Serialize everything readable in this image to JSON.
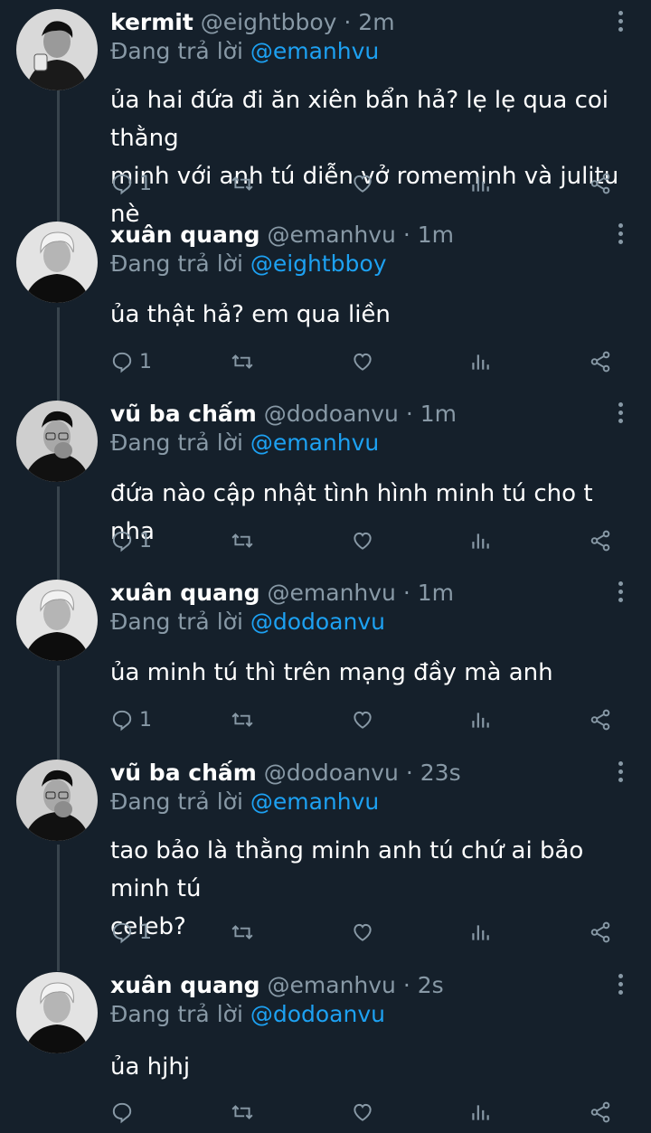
{
  "reply_prefix": "Đang trả lời",
  "tweets": [
    {
      "name": "kermit",
      "handle": "@eightbboy",
      "separator": "·",
      "time": "2m",
      "reply_to": "@emanhvu",
      "text_lines": [
        "ủa hai đứa đi ăn xiên bẩn hả? lẹ lẹ qua coi thằng",
        "minh với anh tú diễn vở romeminh và julitu nè"
      ],
      "reply_count": "1"
    },
    {
      "name": "xuân quang",
      "handle": "@emanhvu",
      "separator": "·",
      "time": "1m",
      "reply_to": "@eightbboy",
      "text_lines": [
        "ủa thật hả? em qua liền"
      ],
      "reply_count": "1"
    },
    {
      "name": "vũ ba chấm",
      "handle": "@dodoanvu",
      "separator": "·",
      "time": "1m",
      "reply_to": "@emanhvu",
      "text_lines": [
        "đứa nào cập nhật tình hình minh tú cho t nha"
      ],
      "reply_count": "1"
    },
    {
      "name": "xuân quang",
      "handle": "@emanhvu",
      "separator": "·",
      "time": "1m",
      "reply_to": "@dodoanvu",
      "text_lines": [
        "ủa minh tú thì trên mạng đầy mà anh"
      ],
      "reply_count": "1"
    },
    {
      "name": "vũ ba chấm",
      "handle": "@dodoanvu",
      "separator": "·",
      "time": "23s",
      "reply_to": "@emanhvu",
      "text_lines": [
        "tao bảo là thằng minh anh tú chứ ai bảo minh tú",
        "celeb?"
      ],
      "reply_count": "1"
    },
    {
      "name": "xuân quang",
      "handle": "@emanhvu",
      "separator": "·",
      "time": "2s",
      "reply_to": "@dodoanvu",
      "text_lines": [
        "ủa hjhj"
      ],
      "reply_count": ""
    }
  ],
  "icons": {
    "reply": "reply-icon",
    "retweet": "retweet-icon",
    "like": "like-icon",
    "analytics": "analytics-icon",
    "share": "share-icon",
    "more": "more-vertical-icon"
  },
  "colors": {
    "background": "#15202b",
    "muted": "#8899a6",
    "mention": "#1da1f2",
    "thread_line": "#38444d"
  }
}
